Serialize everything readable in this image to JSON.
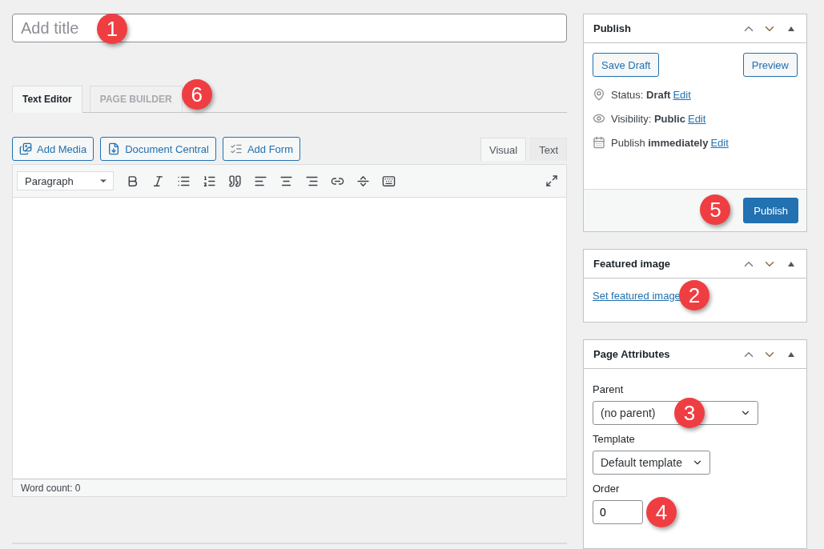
{
  "title_field": {
    "placeholder": "Add title",
    "callout": "1"
  },
  "editor_tabs": [
    {
      "label": "Text Editor",
      "selected": true
    },
    {
      "label": "PAGE BUILDER",
      "selected": false,
      "callout": "6"
    }
  ],
  "media_buttons": [
    {
      "label": "Add Media",
      "kind": "media"
    },
    {
      "label": "Document Central",
      "kind": "document"
    },
    {
      "label": "Add Form",
      "kind": "form"
    }
  ],
  "mode_tabs": [
    {
      "label": "Visual",
      "selected": true
    },
    {
      "label": "Text",
      "selected": false
    }
  ],
  "format_select": {
    "value": "Paragraph"
  },
  "word_count": "Word count: 0",
  "publish_box": {
    "title": "Publish",
    "save_draft": "Save Draft",
    "preview": "Preview",
    "rows": [
      {
        "kind": "status",
        "text": "Status: **Draft**",
        "link": "Edit"
      },
      {
        "kind": "visibility",
        "text": "Visibility: **Public**",
        "link": "Edit"
      },
      {
        "kind": "schedule",
        "text": "Publish **immediately**",
        "link": "Edit"
      }
    ],
    "publish_button": "Publish",
    "callout": "5"
  },
  "featured_image_box": {
    "title": "Featured image",
    "link": "Set featured image",
    "callout": "2"
  },
  "page_attributes_box": {
    "title": "Page Attributes",
    "parent": {
      "label": "Parent",
      "value": "(no parent)",
      "callout": "3"
    },
    "template": {
      "label": "Template",
      "value": "Default template"
    },
    "order": {
      "label": "Order",
      "value": "0",
      "callout": "4"
    }
  }
}
